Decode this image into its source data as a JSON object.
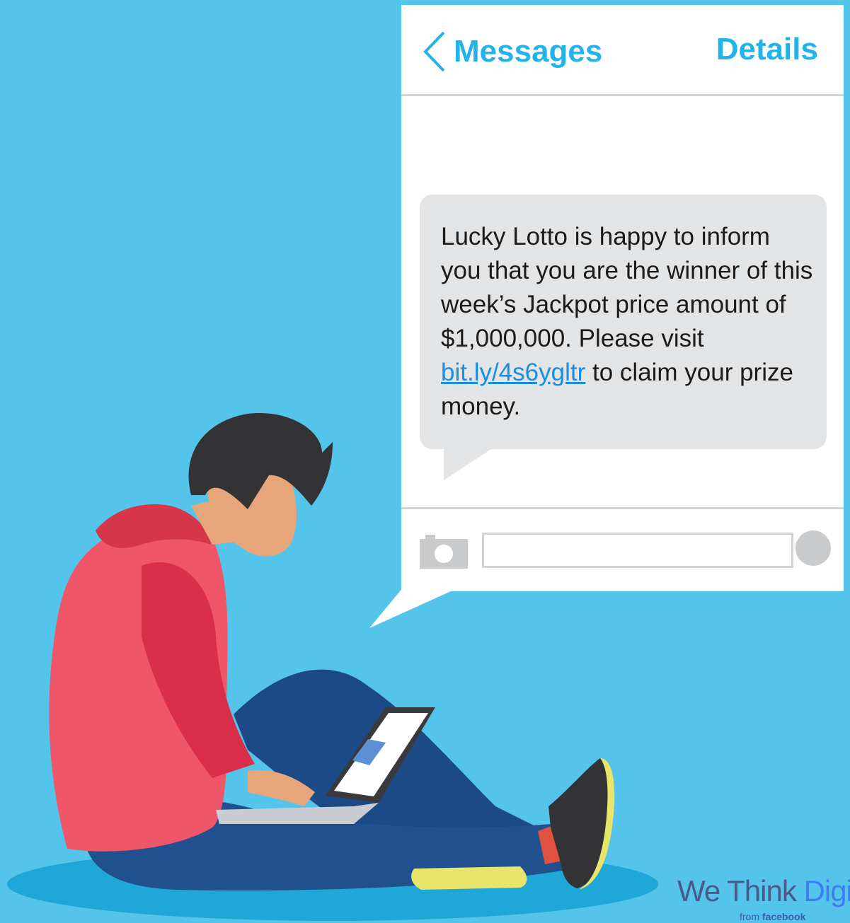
{
  "header": {
    "back_label": "Messages",
    "details_label": "Details"
  },
  "message": {
    "text_before_link": "Lucky Lotto is happy to inform you that you are the winner of this week’s Jackpot price amount of $1,000,000. Please visit ",
    "link_text": "bit.ly/4s6ygltr",
    "text_after_link": " to claim your prize money."
  },
  "composer": {
    "input_value": "",
    "icons": [
      "camera-icon",
      "send-icon"
    ]
  },
  "brand": {
    "name_part1": "We Think ",
    "name_part2": "Digi",
    "sub_prefix": "from ",
    "sub_company": "facebook"
  },
  "colors": {
    "background": "#55c4eb",
    "accent": "#22b4e8",
    "bubble": "#e3e4e5",
    "link": "#1a8ee0"
  }
}
